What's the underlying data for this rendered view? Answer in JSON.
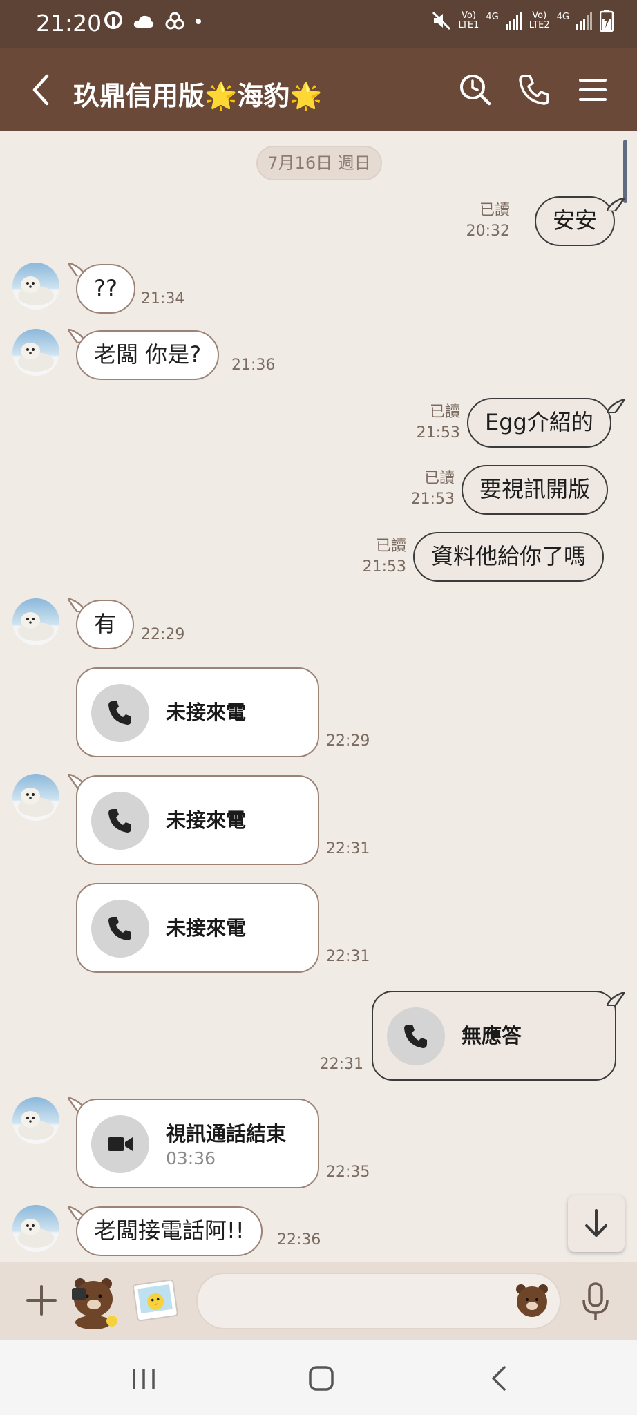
{
  "status_bar": {
    "time": "21:20",
    "sim1_label_top": "Vo)",
    "sim1_label_bottom": "LTE1",
    "sim1_net": "4G",
    "sim2_label_top": "Vo)",
    "sim2_label_bottom": "LTE2",
    "sim2_net": "4G",
    "icons": [
      "muted-icon",
      "signal-icon",
      "battery-charging-icon"
    ]
  },
  "header": {
    "title": "玖鼎信用版🌟海豹🌟",
    "icons": [
      "back-icon",
      "search-clock-icon",
      "phone-icon",
      "menu-icon"
    ]
  },
  "date_divider": "7月16日 週日",
  "messages": [
    {
      "id": "m1",
      "side": "mine",
      "text": "安安",
      "read": "已讀",
      "time": "20:32"
    },
    {
      "id": "m2",
      "side": "theirs",
      "text": "??",
      "time": "21:34"
    },
    {
      "id": "m3",
      "side": "theirs",
      "text": "老闆 你是?",
      "time": "21:36"
    },
    {
      "id": "m4",
      "side": "mine",
      "text": "Egg介紹的",
      "read": "已讀",
      "time": "21:53"
    },
    {
      "id": "m5",
      "side": "mine",
      "text": "要視訊開版",
      "read": "已讀",
      "time": "21:53"
    },
    {
      "id": "m6",
      "side": "mine",
      "text": "資料他給你了嗎",
      "read": "已讀",
      "time": "21:53"
    },
    {
      "id": "m7",
      "side": "theirs",
      "text": "有",
      "time": "22:29"
    },
    {
      "id": "c1",
      "side": "theirs",
      "kind": "call",
      "text": "未接來電",
      "time": "22:29"
    },
    {
      "id": "c2",
      "side": "theirs",
      "kind": "call",
      "text": "未接來電",
      "time": "22:31"
    },
    {
      "id": "c3",
      "side": "theirs",
      "kind": "call",
      "text": "未接來電",
      "time": "22:31"
    },
    {
      "id": "c4",
      "side": "mine",
      "kind": "call",
      "text": "無應答",
      "time": "22:31"
    },
    {
      "id": "c5",
      "side": "theirs",
      "kind": "video",
      "text": "視訊通話結束",
      "duration": "03:36",
      "time": "22:35"
    },
    {
      "id": "m8",
      "side": "theirs",
      "text": "老闆接電話阿!!",
      "time": "22:36"
    }
  ],
  "input": {
    "placeholder": "",
    "value": ""
  },
  "colors": {
    "status_bar": "#5d4335",
    "header": "#6b4939",
    "chat_bg": "#f1ebe6",
    "my_bubble": "#efe8e2",
    "their_bubble": "#ffffff"
  }
}
